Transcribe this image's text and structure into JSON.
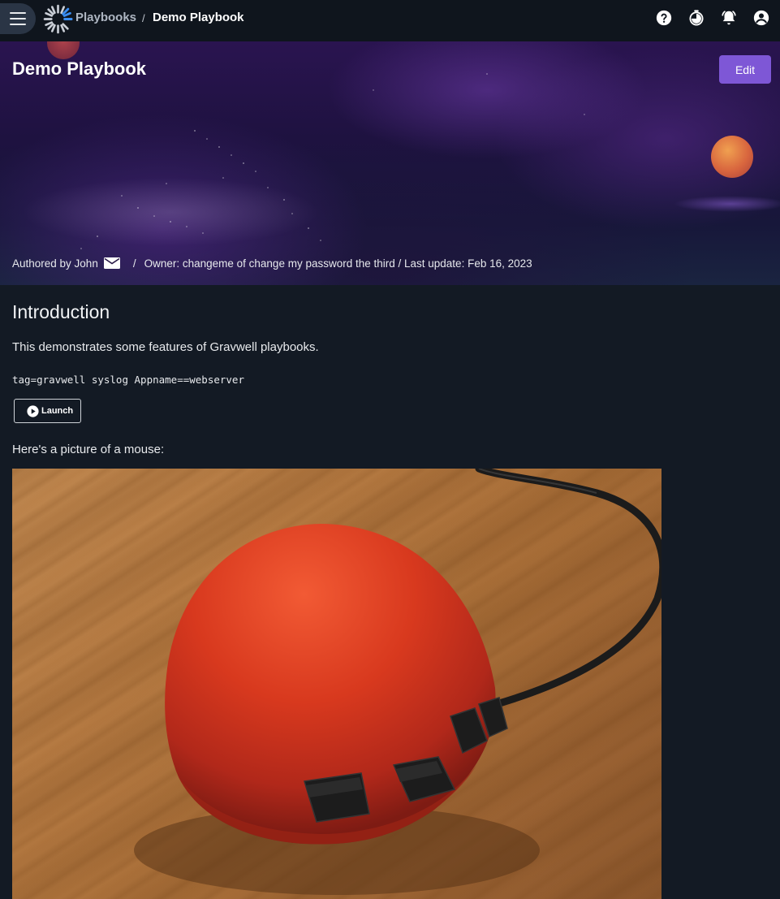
{
  "topbar": {
    "menu_icon": "hamburger-icon",
    "logo_icon": "gravwell-logo-icon",
    "breadcrumb_parent": "Playbooks",
    "breadcrumb_separator": "/",
    "breadcrumb_current": "Demo Playbook",
    "icons": [
      "help-icon",
      "timer-icon",
      "notifications-icon",
      "account-icon"
    ]
  },
  "hero": {
    "title": "Demo Playbook",
    "edit_label": "Edit",
    "authored_by": "Authored by John",
    "separator": "/",
    "owner_line": "Owner: changeme of change my password the third / Last update: Feb 16, 2023"
  },
  "content": {
    "heading": "Introduction",
    "paragraph1": "This demonstrates some features of Gravwell playbooks.",
    "query": "tag=gravwell syslog Appname==webserver",
    "launch_label": "Launch",
    "paragraph2": "Here's a picture of a mouse:"
  },
  "colors": {
    "background": "#131a24",
    "topbar": "#0f151d",
    "accent": "#7e57d6"
  }
}
